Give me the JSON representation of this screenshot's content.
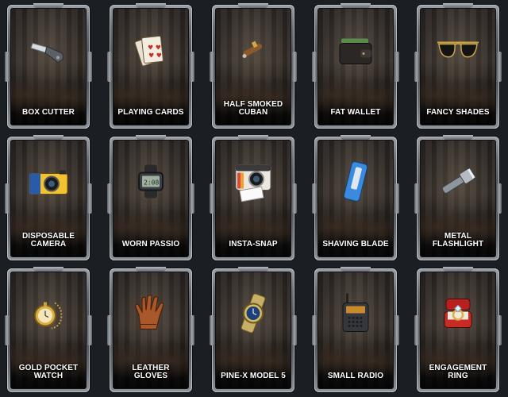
{
  "items": [
    {
      "label": "BOX CUTTER",
      "icon": "box-cutter-icon"
    },
    {
      "label": "PLAYING CARDS",
      "icon": "playing-cards-icon"
    },
    {
      "label": "HALF SMOKED CUBAN",
      "icon": "cigar-icon"
    },
    {
      "label": "FAT WALLET",
      "icon": "wallet-icon"
    },
    {
      "label": "FANCY SHADES",
      "icon": "sunglasses-icon"
    },
    {
      "label": "DISPOSABLE CAMERA",
      "icon": "disposable-camera-icon"
    },
    {
      "label": "WORN PASSIO",
      "icon": "digital-watch-icon"
    },
    {
      "label": "INSTA-SNAP",
      "icon": "instant-camera-icon"
    },
    {
      "label": "SHAVING BLADE",
      "icon": "razor-icon"
    },
    {
      "label": "METAL FLASHLIGHT",
      "icon": "flashlight-icon"
    },
    {
      "label": "GOLD POCKET WATCH",
      "icon": "pocket-watch-icon"
    },
    {
      "label": "LEATHER GLOVES",
      "icon": "glove-icon"
    },
    {
      "label": "PINE-X MODEL 5",
      "icon": "wristwatch-icon"
    },
    {
      "label": "SMALL RADIO",
      "icon": "radio-icon"
    },
    {
      "label": "ENGAGEMENT RING",
      "icon": "ring-box-icon"
    }
  ]
}
